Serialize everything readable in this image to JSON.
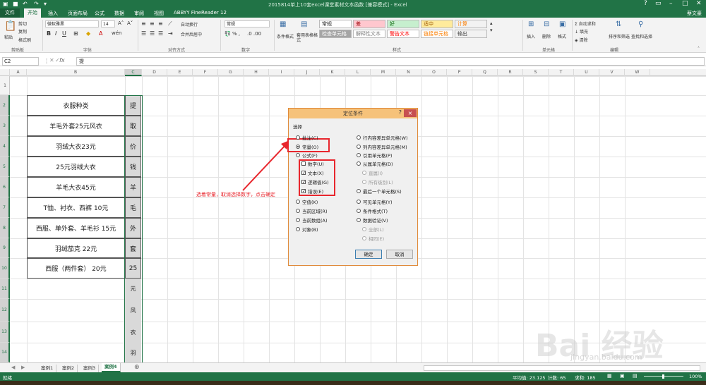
{
  "window": {
    "title": "2015814单上10套excel课堂素材文本函数 [兼容模式] - Excel",
    "user": "蔡文豪"
  },
  "ribbon_tabs": [
    "文件",
    "开始",
    "插入",
    "页面布局",
    "公式",
    "数据",
    "审阅",
    "视图",
    "ABBYY FineReader 12"
  ],
  "ribbon": {
    "clipboard": {
      "paste": "粘贴",
      "cut": "剪切",
      "copy": "复制",
      "format_painter": "格式刷",
      "label": "剪贴板"
    },
    "font": {
      "name": "微软雅黑",
      "size": "14",
      "label": "字体"
    },
    "alignment": {
      "wrap": "自动换行",
      "merge": "合并后居中",
      "label": "对齐方式"
    },
    "number": {
      "format": "常规",
      "label": "数字"
    },
    "styles": {
      "conditional": "条件格式",
      "table": "套用表格格式",
      "cells": [
        {
          "text": "常规",
          "bg": "#ffffff",
          "fg": "#222222"
        },
        {
          "text": "差",
          "bg": "#ffc7ce",
          "fg": "#9c0006"
        },
        {
          "text": "好",
          "bg": "#c6efce",
          "fg": "#006100"
        },
        {
          "text": "适中",
          "bg": "#ffeb9c",
          "fg": "#9c5700"
        },
        {
          "text": "计算",
          "bg": "#f2f2f2",
          "fg": "#fa7d00"
        },
        {
          "text": "检查单元格",
          "bg": "#a5a5a5",
          "fg": "#ffffff"
        },
        {
          "text": "解释性文本",
          "bg": "#ffffff",
          "fg": "#7f7f7f"
        },
        {
          "text": "警告文本",
          "bg": "#ffffff",
          "fg": "#ff0000"
        },
        {
          "text": "链接单元格",
          "bg": "#ffffff",
          "fg": "#fa7d00"
        },
        {
          "text": "输出",
          "bg": "#f2f2f2",
          "fg": "#3f3f3f"
        }
      ],
      "label": "样式"
    },
    "cells_group": {
      "insert": "插入",
      "delete": "删除",
      "format": "格式",
      "label": "单元格"
    },
    "editing": {
      "autosum": "自动求和",
      "fill": "填充",
      "clear": "清除",
      "sort": "排序和筛选",
      "find": "查找和选择",
      "label": "编辑"
    }
  },
  "formula_bar": {
    "name_box": "C2",
    "fx": "fx",
    "content": "提"
  },
  "columns": [
    "A",
    "B",
    "C",
    "D",
    "E",
    "F",
    "G",
    "H",
    "I",
    "J",
    "K",
    "L",
    "M",
    "N",
    "O",
    "P",
    "Q",
    "R",
    "S",
    "T",
    "U",
    "V",
    "W"
  ],
  "rows": [
    "1",
    "2",
    "3",
    "4",
    "5",
    "6",
    "7",
    "8",
    "9",
    "10",
    "11",
    "12",
    "13",
    "14"
  ],
  "table_b": [
    "衣服种类",
    "羊毛外套25元风衣",
    "羽绒大衣23元",
    "25元羽绒大衣",
    "羊毛大衣45元",
    "T恤、衬衣、西裤 10元",
    "西服、单外套、羊毛衫 15元",
    "羽绒茄克 22元",
    "西服（两件套） 20元"
  ],
  "table_c": [
    "提",
    "取",
    "价",
    "钱",
    "羊",
    "毛",
    "外",
    "套",
    "25"
  ],
  "overflow_c": [
    "元",
    "风",
    "衣",
    "羽"
  ],
  "dialog": {
    "title": "定位条件",
    "help": "?",
    "close": "×",
    "group": "选择",
    "left": [
      {
        "label": "批注(C)",
        "type": "radio"
      },
      {
        "label": "常量(O)",
        "type": "radio",
        "selected": true
      },
      {
        "label": "公式(F)",
        "type": "radio"
      },
      {
        "label": "数字(U)",
        "type": "check",
        "checked": false
      },
      {
        "label": "文本(X)",
        "type": "check",
        "checked": true
      },
      {
        "label": "逻辑值(G)",
        "type": "check",
        "checked": true
      },
      {
        "label": "错误(E)",
        "type": "check",
        "checked": true
      },
      {
        "label": "空值(K)",
        "type": "radio"
      },
      {
        "label": "当前区域(R)",
        "type": "radio"
      },
      {
        "label": "当前数组(A)",
        "type": "radio"
      },
      {
        "label": "对象(B)",
        "type": "radio"
      }
    ],
    "right": [
      {
        "label": "行内容差异单元格(W)",
        "type": "radio"
      },
      {
        "label": "列内容差异单元格(M)",
        "type": "radio"
      },
      {
        "label": "引用单元格(P)",
        "type": "radio"
      },
      {
        "label": "从属单元格(D)",
        "type": "radio"
      },
      {
        "label": "直属(I)",
        "type": "sub"
      },
      {
        "label": "所有级别(L)",
        "type": "sub"
      },
      {
        "label": "最后一个单元格(S)",
        "type": "radio"
      },
      {
        "label": "可见单元格(Y)",
        "type": "radio"
      },
      {
        "label": "条件格式(T)",
        "type": "radio"
      },
      {
        "label": "数据验证(V)",
        "type": "radio"
      },
      {
        "label": "全部(L)",
        "type": "sub"
      },
      {
        "label": "相同(E)",
        "type": "sub"
      }
    ],
    "ok": "确定",
    "cancel": "取消"
  },
  "annotation": "选着常量，取消选择数字，点击确定",
  "sheets": [
    "案例1",
    "案例2",
    "案例3",
    "案例4"
  ],
  "active_sheet": "案例4",
  "status": {
    "ready": "就绪",
    "average": "平均值: 23.125",
    "count": "计数: 65",
    "sum": "求和: 185",
    "zoom": "100%"
  },
  "watermark": {
    "text": "Bai 经验",
    "url": "jingyan.baidu.com"
  }
}
